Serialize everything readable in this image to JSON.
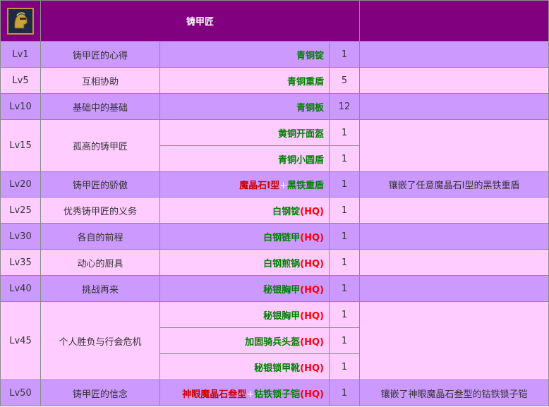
{
  "header": {
    "title": "铸甲匠",
    "avatar_icon": "armorer-helmet-icon"
  },
  "quests": [
    {
      "level": "Lv1",
      "name": "铸甲匠的心得",
      "items": [
        {
          "parts": [
            {
              "text": "青铜锭",
              "color": "green"
            }
          ],
          "qty": "1"
        }
      ],
      "note": ""
    },
    {
      "level": "Lv5",
      "name": "互相协助",
      "items": [
        {
          "parts": [
            {
              "text": "青铜重盾",
              "color": "green"
            }
          ],
          "qty": "5"
        }
      ],
      "note": ""
    },
    {
      "level": "Lv10",
      "name": "基础中的基础",
      "items": [
        {
          "parts": [
            {
              "text": "青铜板",
              "color": "green"
            }
          ],
          "qty": "12"
        }
      ],
      "note": ""
    },
    {
      "level": "Lv15",
      "name": "孤高的铸甲匠",
      "items": [
        {
          "parts": [
            {
              "text": "黄铜开面盔",
              "color": "green"
            }
          ],
          "qty": "1"
        },
        {
          "parts": [
            {
              "text": "青铜小圆盾",
              "color": "green"
            }
          ],
          "qty": "1"
        }
      ],
      "note": ""
    },
    {
      "level": "Lv20",
      "name": "铸甲匠的骄傲",
      "items": [
        {
          "parts": [
            {
              "text": "魔晶石Ⅰ型",
              "color": "darkred"
            },
            {
              "text": "+",
              "color": "white"
            },
            {
              "text": "黑铁重盾",
              "color": "green"
            }
          ],
          "qty": "1"
        }
      ],
      "note": "镶嵌了任意魔晶石Ⅰ型的黑铁重盾"
    },
    {
      "level": "Lv25",
      "name": "优秀铸甲匠的义务",
      "items": [
        {
          "parts": [
            {
              "text": "白钢锭",
              "color": "green"
            },
            {
              "text": "(HQ)",
              "color": "red"
            }
          ],
          "qty": "1"
        }
      ],
      "note": ""
    },
    {
      "level": "Lv30",
      "name": "各自的前程",
      "items": [
        {
          "parts": [
            {
              "text": "白钢链甲",
              "color": "green"
            },
            {
              "text": "(HQ)",
              "color": "red"
            }
          ],
          "qty": "1"
        }
      ],
      "note": ""
    },
    {
      "level": "Lv35",
      "name": "动心的厨具",
      "items": [
        {
          "parts": [
            {
              "text": "白钢煎锅",
              "color": "green"
            },
            {
              "text": "(HQ)",
              "color": "red"
            }
          ],
          "qty": "1"
        }
      ],
      "note": ""
    },
    {
      "level": "Lv40",
      "name": "挑战再来",
      "items": [
        {
          "parts": [
            {
              "text": "秘银胸甲",
              "color": "green"
            },
            {
              "text": "(HQ)",
              "color": "red"
            }
          ],
          "qty": "1"
        }
      ],
      "note": ""
    },
    {
      "level": "Lv45",
      "name": "个人胜负与行会危机",
      "items": [
        {
          "parts": [
            {
              "text": "秘银胸甲",
              "color": "green"
            },
            {
              "text": "(HQ)",
              "color": "red"
            }
          ],
          "qty": "1"
        },
        {
          "parts": [
            {
              "text": "加固骑兵头盔",
              "color": "green"
            },
            {
              "text": "(HQ)",
              "color": "red"
            }
          ],
          "qty": "1"
        },
        {
          "parts": [
            {
              "text": "秘银锁甲靴",
              "color": "green"
            },
            {
              "text": "(HQ)",
              "color": "red"
            }
          ],
          "qty": "1"
        }
      ],
      "note": ""
    },
    {
      "level": "Lv50",
      "name": "铸甲匠的信念",
      "items": [
        {
          "parts": [
            {
              "text": "神眼魔晶石叁型",
              "color": "darkred"
            },
            {
              "text": "+",
              "color": "white"
            },
            {
              "text": "钴铁锁子铠",
              "color": "green"
            },
            {
              "text": "(HQ)",
              "color": "red"
            }
          ],
          "qty": "1"
        }
      ],
      "note": "镶嵌了神眼魔晶石叁型的钴铁锁子铠"
    }
  ]
}
